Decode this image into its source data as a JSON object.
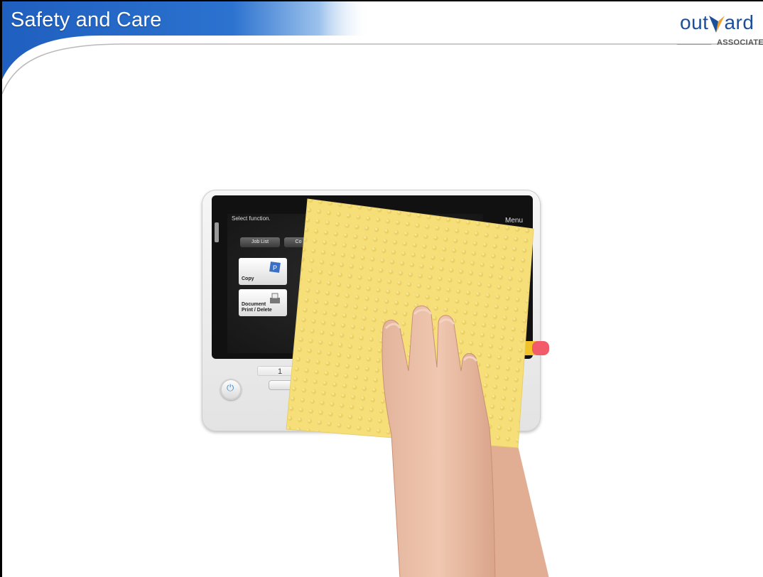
{
  "header": {
    "title": "Safety and Care"
  },
  "logo": {
    "word_left": "out",
    "word_right": "ard",
    "subtitle": "ASSOCIATE"
  },
  "device_screen": {
    "prompt": "Select function.",
    "menu_label": "Menu",
    "buttons": [
      "Job List",
      "Co"
    ],
    "tiles": [
      {
        "label_line1": "Copy",
        "label_line2": ""
      },
      {
        "label_line1": "Document",
        "label_line2": "Print / Delete"
      }
    ],
    "key_number": "1"
  },
  "colors": {
    "header_blue": "#1c5db5",
    "logo_blue": "#1a4f9c",
    "cloth_yellow": "#f7e27c"
  }
}
